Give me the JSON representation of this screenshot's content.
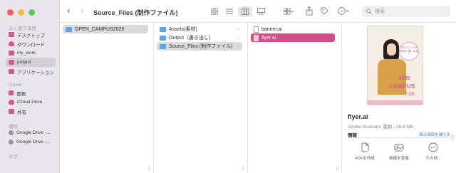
{
  "window": {
    "title": "Source_Files (制作ファイル)",
    "accent": "#d34e88"
  },
  "sidebar": {
    "favorites_label": "よく使う項目",
    "favorites": [
      {
        "label": "デスクトップ",
        "icon": "desktop-folder-icon"
      },
      {
        "label": "ダウンロード",
        "icon": "download-icon"
      },
      {
        "label": "my_work",
        "icon": "folder-icon"
      },
      {
        "label": "project",
        "icon": "folder-icon"
      },
      {
        "label": "アプリケーション",
        "icon": "applications-icon"
      }
    ],
    "icloud_label": "iCloud",
    "icloud": [
      {
        "label": "書類",
        "icon": "document-icon"
      },
      {
        "label": "iCloud Drive",
        "icon": "cloud-icon"
      },
      {
        "label": "共有",
        "icon": "shared-folder-icon"
      }
    ],
    "locations_label": "場所",
    "locations": [
      {
        "label": "Google Drive -...",
        "icon": "drive-icon"
      },
      {
        "label": "Google Drive -...",
        "icon": "drive-icon"
      }
    ],
    "tags_label": "タグ"
  },
  "toolbar": {
    "back": "‹",
    "forward": "›",
    "search_placeholder": "検索"
  },
  "columns": {
    "col1": [
      "OPEN_CAMPUS2025"
    ],
    "col2": [
      "Assets(素材)",
      "Output（書き出し）",
      "Source_Files (制作ファイル)"
    ],
    "col3": [
      "banner.ai",
      "flyer.ai"
    ]
  },
  "preview": {
    "poster_bubble": "\"学び\"たい その気持ち 輝く未来へ",
    "poster_year": "2025",
    "poster_campus": "CAMPUS",
    "poster_date": "7.06",
    "file_name": "flyer.ai",
    "meta": "Adobe Illustrator 書類 - 28.8 MB",
    "info_label": "情報",
    "more_label": "表示項目を減らす",
    "actions": [
      {
        "label": "PDFを作成",
        "icon": "pdf-icon"
      },
      {
        "label": "画像を変換",
        "icon": "image-convert-icon"
      },
      {
        "label": "その他...",
        "icon": "more-icon"
      }
    ]
  }
}
